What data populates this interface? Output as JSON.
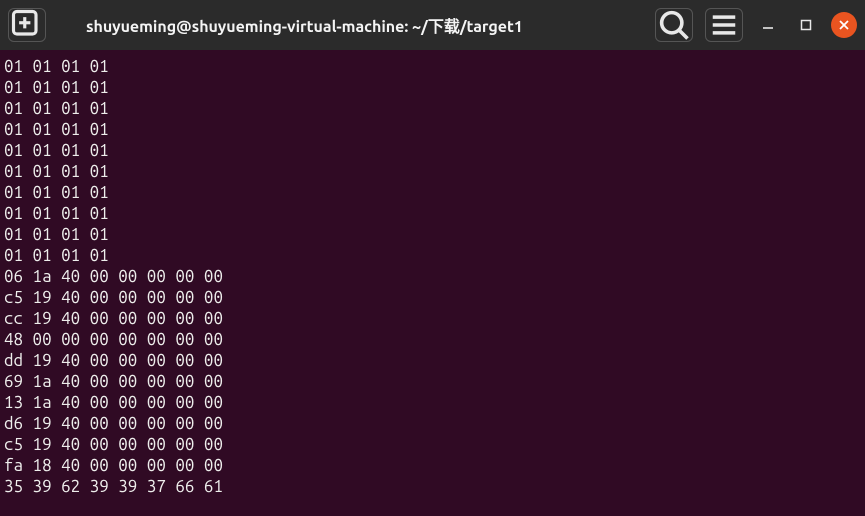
{
  "titlebar": {
    "title": "shuyueming@shuyueming-virtual-machine: ~/下载/target1"
  },
  "terminal": {
    "lines": [
      "01 01 01 01",
      "01 01 01 01",
      "01 01 01 01",
      "01 01 01 01",
      "01 01 01 01",
      "01 01 01 01",
      "01 01 01 01",
      "01 01 01 01",
      "01 01 01 01",
      "01 01 01 01",
      "06 1a 40 00 00 00 00 00",
      "c5 19 40 00 00 00 00 00",
      "cc 19 40 00 00 00 00 00",
      "48 00 00 00 00 00 00 00",
      "dd 19 40 00 00 00 00 00",
      "69 1a 40 00 00 00 00 00",
      "13 1a 40 00 00 00 00 00",
      "d6 19 40 00 00 00 00 00",
      "c5 19 40 00 00 00 00 00",
      "fa 18 40 00 00 00 00 00",
      "35 39 62 39 39 37 66 61"
    ]
  }
}
